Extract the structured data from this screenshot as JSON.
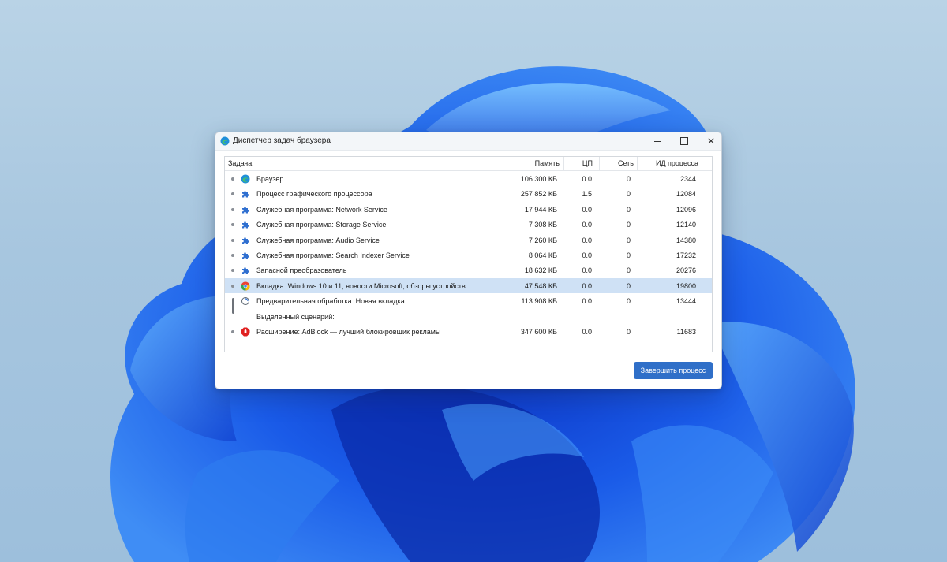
{
  "window": {
    "title": "Диспетчер задач браузера"
  },
  "columns": {
    "task": "Задача",
    "memory": "Память",
    "cpu": "ЦП",
    "network": "Сеть",
    "pid": "ИД процесса"
  },
  "rows": [
    {
      "icon": "edge-icon",
      "title": "Браузер",
      "memory": "106 300 КБ",
      "cpu": "0.0",
      "network": "0",
      "pid": "2344",
      "selected": false
    },
    {
      "icon": "puzzle-icon",
      "title": "Процесс графического процессора",
      "memory": "257 852 КБ",
      "cpu": "1.5",
      "network": "0",
      "pid": "12084",
      "selected": false
    },
    {
      "icon": "puzzle-icon",
      "title": "Служебная программа: Network Service",
      "memory": "17 944 КБ",
      "cpu": "0.0",
      "network": "0",
      "pid": "12096",
      "selected": false
    },
    {
      "icon": "puzzle-icon",
      "title": "Служебная программа: Storage Service",
      "memory": "7 308 КБ",
      "cpu": "0.0",
      "network": "0",
      "pid": "12140",
      "selected": false
    },
    {
      "icon": "puzzle-icon",
      "title": "Служебная программа: Audio Service",
      "memory": "7 260 КБ",
      "cpu": "0.0",
      "network": "0",
      "pid": "14380",
      "selected": false
    },
    {
      "icon": "puzzle-icon",
      "title": "Служебная программа: Search Indexer Service",
      "memory": "8 064 КБ",
      "cpu": "0.0",
      "network": "0",
      "pid": "17232",
      "selected": false
    },
    {
      "icon": "puzzle-icon",
      "title": "Запасной преобразователь",
      "memory": "18 632 КБ",
      "cpu": "0.0",
      "network": "0",
      "pid": "20276",
      "selected": false
    },
    {
      "icon": "chrome-icon",
      "title": "Вкладка: Windows 10 и 11, новости Microsoft, обзоры устройств",
      "memory": "47 548 КБ",
      "cpu": "0.0",
      "network": "0",
      "pid": "19800",
      "selected": true
    },
    {
      "icon": "loading-icon",
      "title": "Предварительная обработка: Новая вкладка",
      "memory": "113 908 КБ",
      "cpu": "0.0",
      "network": "0",
      "pid": "13444",
      "selected": false
    },
    {
      "icon": "",
      "title": "Выделенный сценарий:",
      "memory": "",
      "cpu": "",
      "network": "",
      "pid": "",
      "selected": false
    },
    {
      "icon": "adblock-icon",
      "title": "Расширение: AdBlock — лучший блокировщик рекламы",
      "memory": "347 600 КБ",
      "cpu": "0.0",
      "network": "0",
      "pid": "11683",
      "selected": false
    }
  ],
  "actions": {
    "end_process": "Завершить процесс"
  },
  "colors": {
    "accent": "#2f6fc8",
    "selected_row": "#cfe1f5"
  }
}
